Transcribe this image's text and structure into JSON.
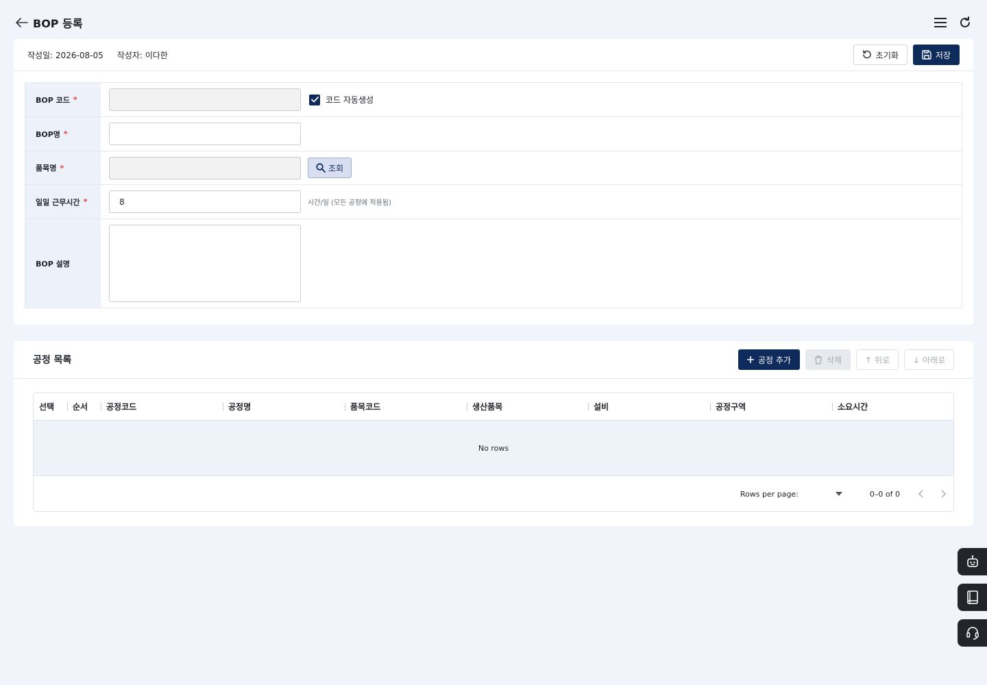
{
  "header": {
    "title": "BOP 등록",
    "back_icon": "arrow-left-icon",
    "menu_icon": "hamburger-menu-icon",
    "refresh_icon": "refresh-icon"
  },
  "meta": {
    "created_date": "작성일: 2026-08-05",
    "author": "작성자: 이다한"
  },
  "actions": {
    "reset_label": "초기화",
    "save_label": "저장"
  },
  "form": {
    "bop_code": {
      "label": "BOP 코드",
      "required": "*",
      "value": "",
      "auto_generate_label": "코드 자동생성",
      "auto_generate_checked": true
    },
    "bop_name": {
      "label": "BOP명",
      "required": "*",
      "value": ""
    },
    "item_name": {
      "label": "품목명",
      "required": "*",
      "value": "",
      "search_label": "조회"
    },
    "daily_hours": {
      "label": "일일 근무시간",
      "required": "*",
      "value": "8",
      "hint": "시간/일 (모든 공정에 적용됨)"
    },
    "description": {
      "label": "BOP 설명",
      "value": ""
    }
  },
  "process_list": {
    "title": "공정 목록",
    "add_label": "공정 추가",
    "delete_label": "삭제",
    "up_label": "↑ 위로",
    "down_label": "↓ 아래로",
    "columns": [
      "선택",
      "순서",
      "공정코드",
      "공정명",
      "품목코드",
      "생산품목",
      "설비",
      "공정구역",
      "소요시간"
    ],
    "empty_text": "No rows",
    "rows_per_page_label": "Rows per page:",
    "pagination_info": "0–0 of 0"
  },
  "floating": [
    "robot-assistant-icon",
    "book-icon",
    "headset-support-icon"
  ],
  "colors": {
    "primary": "#0f2b5b",
    "background": "#f1f4fa",
    "label_bg": "#edf1f9",
    "required": "#e53935"
  }
}
